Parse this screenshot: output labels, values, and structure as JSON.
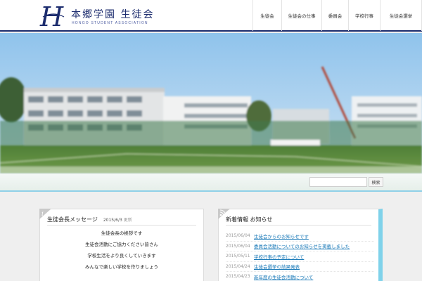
{
  "header": {
    "logo_title": "本郷学園 生徒会",
    "logo_subtitle": "HONGO STUDENT ASSOCIATION",
    "nav": [
      "生徒会",
      "生徒会の仕事",
      "委員会",
      "学校行事",
      "生徒会選挙"
    ]
  },
  "search": {
    "placeholder": "",
    "button_label": "検索"
  },
  "message_panel": {
    "title": "生徒会長メッセージ",
    "date": "2015/6/3",
    "date_suffix": "更新",
    "lines": [
      "生徒会長の挨拶です",
      "生徒会活動にご協力ください皆さん",
      "学校生活をより良くしていきます",
      "みんなで楽しい学校を作りましょう"
    ]
  },
  "news_panel": {
    "title": "新着情報 お知らせ",
    "items": [
      {
        "date": "2015/06/04",
        "title": "生徒会からのお知らせです"
      },
      {
        "date": "2015/06/04",
        "title": "委員会活動についてのお知らせを掲載しました"
      },
      {
        "date": "2015/05/11",
        "title": "学校行事の予定について"
      },
      {
        "date": "2015/04/24",
        "title": "生徒会選挙の結果発表"
      },
      {
        "date": "2015/04/23",
        "title": "新年度の生徒会活動について"
      }
    ]
  },
  "colors": {
    "brand": "#1c2c6e",
    "accent": "#7fd2ea",
    "link": "#1b7ab8"
  }
}
